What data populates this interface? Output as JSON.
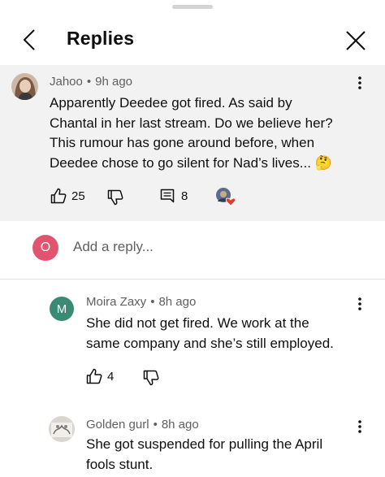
{
  "header": {
    "title": "Replies",
    "back_icon": "chevron-left-icon",
    "close_icon": "close-icon"
  },
  "original_comment": {
    "author": "Jahoo",
    "time": "9h ago",
    "text_lines": [
      "Apparently Deedee got fired. As said by",
      "Chantal in her last stream. Do we believe her?",
      "This rumour has gone around before, when",
      "Deedee chose to go silent for Nad’s lives... 🤔"
    ],
    "likes": "25",
    "replies_count": "8"
  },
  "reply_box": {
    "avatar_letter": "O",
    "avatar_color": "#e2546e",
    "placeholder": "Add a reply..."
  },
  "replies": [
    {
      "author": "Moira Zaxy",
      "time": "8h ago",
      "avatar_letter": "M",
      "avatar_color": "#3b8a76",
      "text_lines": [
        "She did not get fired. We work at the",
        "same company and she’s still employed."
      ],
      "likes": "4"
    },
    {
      "author": "Golden gurl",
      "time": "8h ago",
      "text_lines": [
        "She got suspended for pulling the April",
        "fools stunt."
      ]
    }
  ],
  "separator": "•"
}
